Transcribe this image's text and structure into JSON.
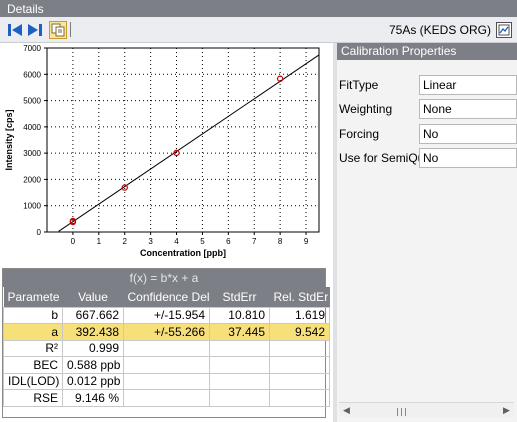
{
  "window": {
    "title": "Details"
  },
  "toolbar": {
    "sample_name": "75As (KEDS ORG)",
    "icons": [
      "first-icon",
      "last-icon",
      "copy-icon",
      "export-icon"
    ]
  },
  "chart_data": {
    "type": "scatter",
    "title": "",
    "xlabel": "Concentration [ppb]",
    "ylabel": "Intensity [cps]",
    "xlim": [
      -1,
      9.5
    ],
    "ylim": [
      0,
      7000
    ],
    "xticks": [
      "0",
      "1",
      "2",
      "3",
      "4",
      "5",
      "6",
      "7",
      "8",
      "9"
    ],
    "yticks": [
      "0",
      "1000",
      "2000",
      "3000",
      "4000",
      "5000",
      "6000",
      "7000"
    ],
    "grid": true,
    "points": {
      "x": [
        0,
        0,
        2,
        4,
        8
      ],
      "y": [
        380,
        420,
        1690,
        3010,
        5830
      ]
    },
    "fit_line": {
      "slope": 667.662,
      "intercept": 392.438,
      "x": [
        -0.55,
        9.5
      ]
    },
    "point_color": "#cc0000",
    "line_color": "#000000"
  },
  "fit": {
    "formula": "f(x) = b*x + a",
    "columns": [
      "Paramete",
      "Value",
      "Confidence Del",
      "StdErr",
      "Rel. StdEr"
    ],
    "rows": [
      {
        "param": "b",
        "value": "667.662",
        "conf": "+/-15.954",
        "stderr": "10.810",
        "rel": "1.619"
      },
      {
        "param": "a",
        "value": "392.438",
        "conf": "+/-55.266",
        "stderr": "37.445",
        "rel": "9.542"
      },
      {
        "param": "R²",
        "value": "0.999",
        "conf": "",
        "stderr": "",
        "rel": ""
      },
      {
        "param": "BEC",
        "value": "0.588 ppb",
        "conf": "",
        "stderr": "",
        "rel": ""
      },
      {
        "param": "IDL(LOD)",
        "value": "0.012 ppb",
        "conf": "",
        "stderr": "",
        "rel": ""
      },
      {
        "param": "RSE",
        "value": "9.146 %",
        "conf": "",
        "stderr": "",
        "rel": ""
      }
    ],
    "selected_row": "a"
  },
  "properties": {
    "header": "Calibration Properties",
    "items": [
      {
        "label": "FitType",
        "value": "Linear"
      },
      {
        "label": "Weighting",
        "value": "None"
      },
      {
        "label": "Forcing",
        "value": "No"
      },
      {
        "label": "Use for SemiQua",
        "value": "No"
      }
    ]
  },
  "colors": {
    "header_bg": "#7c7f86",
    "selected_row": "#f7e07a",
    "icon_blue": "#1f5fc1"
  }
}
